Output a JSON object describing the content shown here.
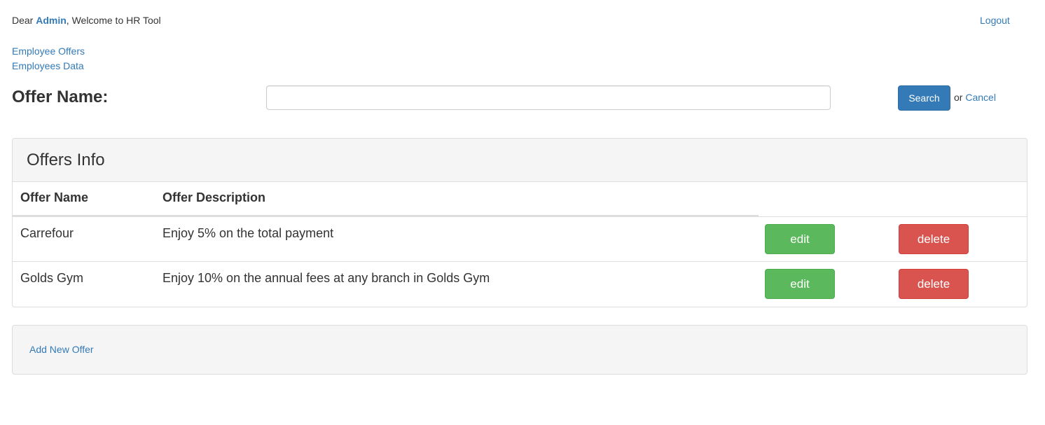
{
  "header": {
    "greeting_prefix": "Dear ",
    "user_name": "Admin",
    "greeting_suffix": ", Welcome to HR Tool",
    "logout_label": "Logout"
  },
  "nav": {
    "links": [
      "Employee Offers",
      "Employees Data"
    ]
  },
  "search": {
    "label": "Offer Name:",
    "input_value": "",
    "search_button": "Search",
    "or_text": "or ",
    "cancel_link": "Cancel"
  },
  "offers_panel": {
    "title": "Offers Info",
    "columns": [
      "Offer Name",
      "Offer Description"
    ],
    "rows": [
      {
        "name": "Carrefour",
        "description": "Enjoy 5% on the total payment",
        "edit_label": "edit",
        "delete_label": "delete"
      },
      {
        "name": "Golds Gym",
        "description": "Enjoy 10% on the annual fees at any branch in Golds Gym",
        "edit_label": "edit",
        "delete_label": "delete"
      }
    ]
  },
  "footer": {
    "add_link": "Add New Offer"
  },
  "colors": {
    "link": "#337ab7",
    "primary": "#337ab7",
    "success": "#5cb85c",
    "danger": "#d9534f",
    "panel_bg": "#f5f5f5"
  }
}
